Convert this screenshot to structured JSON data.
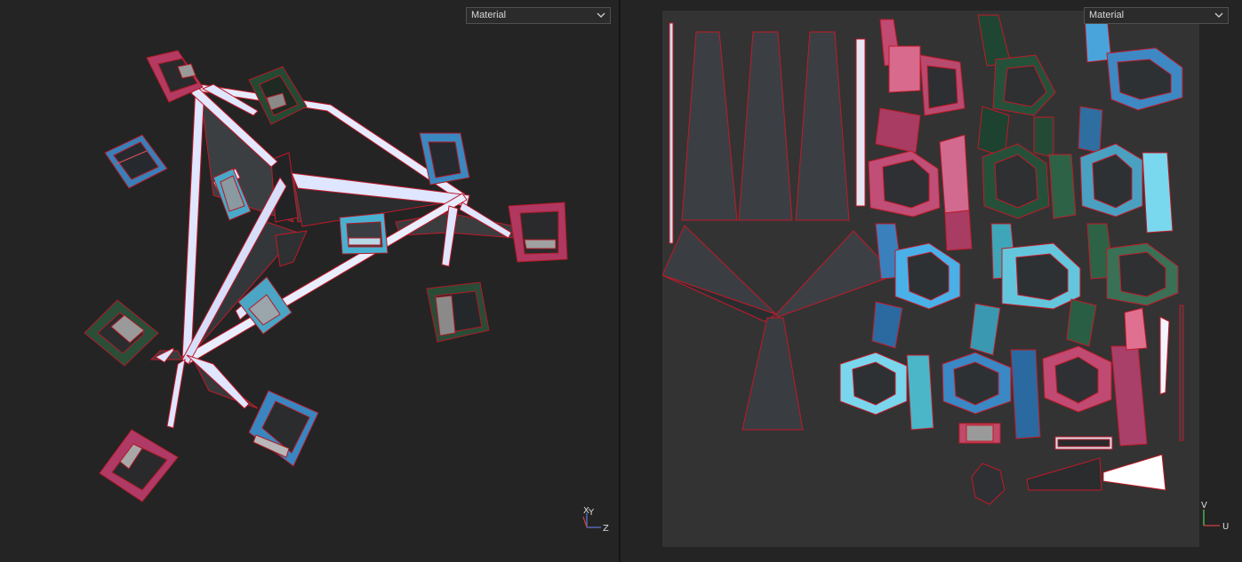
{
  "left_viewport": {
    "shading_mode": "Material",
    "axis": {
      "vertical": "Y",
      "diagonal": "X",
      "horizontal": "Z"
    }
  },
  "right_viewport": {
    "shading_mode": "Material",
    "axis": {
      "vertical": "V",
      "horizontal": "U"
    }
  },
  "colors": {
    "background": "#242424",
    "uv_canvas": "#333333",
    "seam_red": "#d0202a",
    "pink": "#c84a6e",
    "blue": "#3a8fc8",
    "cyan": "#6ac6d8",
    "green": "#2e5e40",
    "truss": "#dde4ff"
  }
}
